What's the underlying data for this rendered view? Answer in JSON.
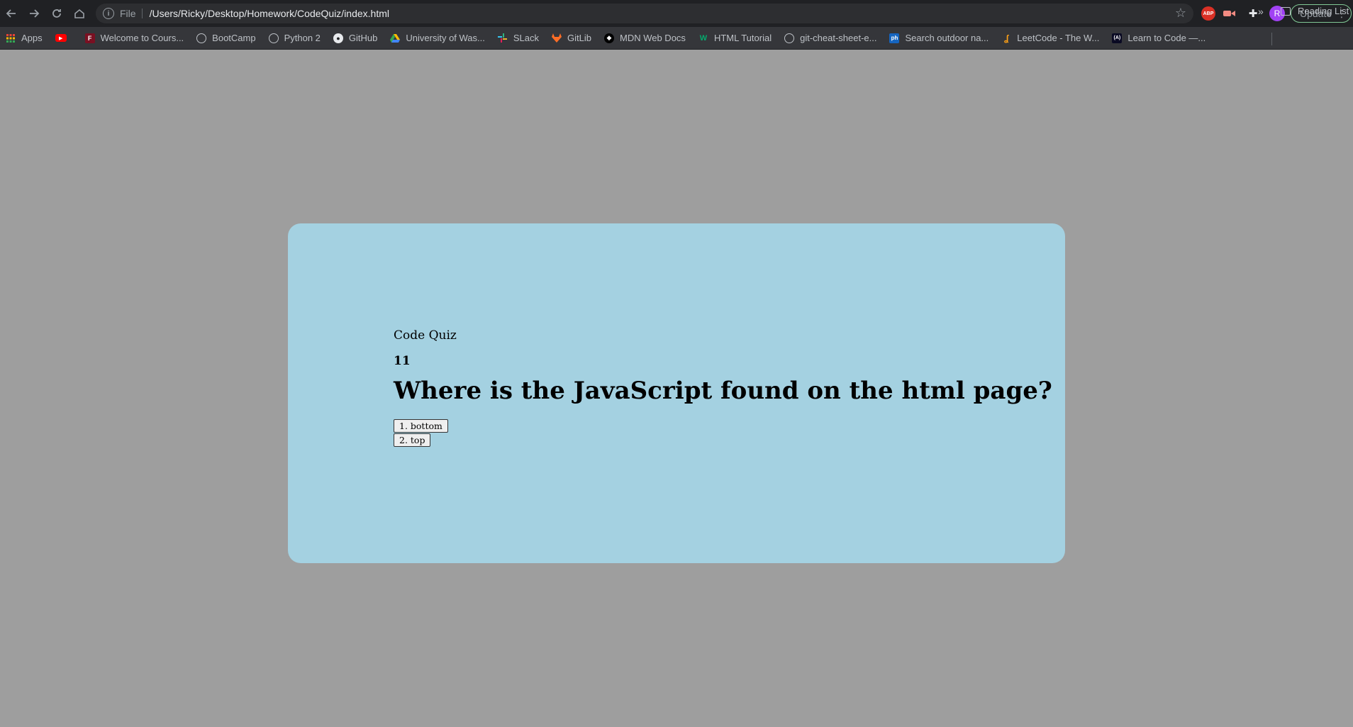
{
  "browser": {
    "address": {
      "scheme": "File",
      "url": "/Users/Ricky/Desktop/Homework/CodeQuiz/index.html"
    },
    "update_label": "Update",
    "avatar_letter": "R",
    "extensions": {
      "abp": "ABP"
    },
    "bookmarks": [
      {
        "label": "Apps",
        "icon": "apps-grid-icon"
      },
      {
        "label": "",
        "icon": "youtube-icon"
      },
      {
        "label": "Welcome to Cours...",
        "icon": "f-logo-icon"
      },
      {
        "label": "BootCamp",
        "icon": "globe-icon"
      },
      {
        "label": "Python 2",
        "icon": "globe-icon"
      },
      {
        "label": "GitHub",
        "icon": "github-icon"
      },
      {
        "label": "University of Was...",
        "icon": "drive-icon"
      },
      {
        "label": "SLack",
        "icon": "slack-icon"
      },
      {
        "label": "GitLib",
        "icon": "gitlab-icon"
      },
      {
        "label": "MDN Web Docs",
        "icon": "mdn-icon"
      },
      {
        "label": "HTML Tutorial",
        "icon": "w3-icon"
      },
      {
        "label": "git-cheat-sheet-e...",
        "icon": "globe-icon"
      },
      {
        "label": "Search outdoor na...",
        "icon": "ph-icon"
      },
      {
        "label": "LeetCode - The W...",
        "icon": "leetcode-icon"
      },
      {
        "label": "Learn to Code —...",
        "icon": "freecodecamp-icon"
      }
    ],
    "more_label": "»",
    "reading_list_label": "Reading List"
  },
  "quiz": {
    "title": "Code Quiz",
    "timer": "11",
    "question": "Where is the JavaScript found on the html page?",
    "choices": [
      "1. bottom",
      "2. top"
    ]
  },
  "colors": {
    "page_bg": "#9e9e9e",
    "card_bg": "#a4d1e1"
  }
}
